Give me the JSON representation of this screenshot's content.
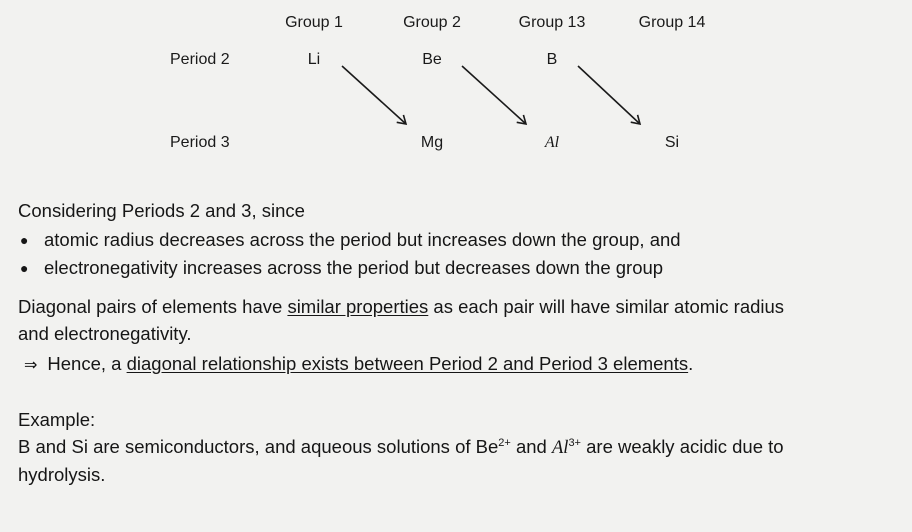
{
  "diagram": {
    "groups": [
      "Group 1",
      "Group 2",
      "Group 13",
      "Group 14"
    ],
    "periods": [
      "Period 2",
      "Period 3"
    ],
    "period2_elements": [
      "Li",
      "Be",
      "B"
    ],
    "period3_elements": [
      "Mg",
      "Al",
      "Si"
    ]
  },
  "intro": "Considering Periods 2 and 3, since",
  "bullets": [
    "atomic radius decreases across the period but increases down the group, and",
    "electronegativity increases across the period but decreases down the group"
  ],
  "para1": {
    "pre": "Diagonal pairs of elements have ",
    "underlined": "similar properties",
    "post": " as each pair will have similar atomic radius",
    "line2": "and electronegativity."
  },
  "conclusion": {
    "arrow": "⇒",
    "pre": "Hence, a ",
    "underlined": "diagonal relationship exists between Period 2 and Period 3 elements",
    "post": "."
  },
  "example": {
    "heading": "Example:",
    "line1_a": "B and Si are semiconductors, and aqueous solutions of Be",
    "be_charge": "2+",
    "line1_b": " and ",
    "al_symbol": "Al",
    "al_charge": "3+",
    "line1_c": " are weakly acidic due to",
    "line2": "hydrolysis."
  }
}
